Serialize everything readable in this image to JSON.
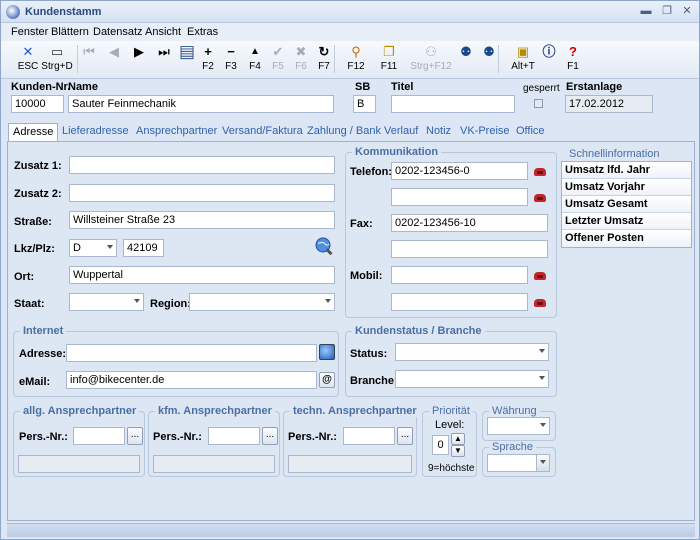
{
  "window": {
    "title": "Kundenstamm"
  },
  "menu": [
    "Fenster",
    "Blättern",
    "Datensatz",
    "Ansicht",
    "Extras"
  ],
  "toolbar": [
    {
      "label": "ESC",
      "icon": "close-icon",
      "symbol": "✕",
      "color": "#1a5cc8"
    },
    {
      "label": "Strg+D",
      "icon": "print-icon",
      "symbol": "🖶",
      "color": "#333"
    },
    {
      "label": "",
      "icon": "first-record-icon",
      "symbol": "⏮",
      "color": "#a6adb8"
    },
    {
      "label": "",
      "icon": "previous-record-icon",
      "symbol": "◀",
      "color": "#a6adb8"
    },
    {
      "label": "",
      "icon": "next-record-icon",
      "symbol": "▶",
      "color": "#222"
    },
    {
      "label": "",
      "icon": "last-record-icon",
      "symbol": "⏭",
      "color": "#222"
    },
    {
      "label": "",
      "icon": "layout-icon",
      "symbol": "▤",
      "color": "#2c4f8a"
    },
    {
      "label": "F2",
      "icon": "add-icon",
      "symbol": "+",
      "color": "#000"
    },
    {
      "label": "F3",
      "icon": "remove-icon",
      "symbol": "−",
      "color": "#000"
    },
    {
      "label": "F4",
      "icon": "edit-icon",
      "symbol": "▲",
      "color": "#000"
    },
    {
      "label": "F5",
      "icon": "check-icon",
      "symbol": "✔",
      "color": "#a6adb8"
    },
    {
      "label": "F6",
      "icon": "cancel-icon",
      "symbol": "✖",
      "color": "#a6adb8"
    },
    {
      "label": "F7",
      "icon": "refresh-icon",
      "symbol": "↻",
      "color": "#000"
    },
    {
      "label": "F12",
      "icon": "broom-icon",
      "symbol": "🧹",
      "color": "#000"
    },
    {
      "label": "F11",
      "icon": "copy-icon",
      "symbol": "❐",
      "color": "#000"
    },
    {
      "label": "Strg+F12",
      "icon": "users-icon",
      "symbol": "👥",
      "color": "#a6adb8"
    },
    {
      "label": "",
      "icon": "contacts-icon",
      "symbol": "☎",
      "color": "#1a4a8a"
    },
    {
      "label": "",
      "icon": "contacts-alt-icon",
      "symbol": "☏",
      "color": "#1a4a8a"
    },
    {
      "label": "Alt+T",
      "icon": "notes-icon",
      "symbol": "▣",
      "color": "#b58a00"
    },
    {
      "label": "",
      "icon": "info-icon",
      "symbol": "ℹ",
      "color": "#1a3c8a"
    },
    {
      "label": "F1",
      "icon": "help-icon",
      "symbol": "?",
      "color": "#c00"
    }
  ],
  "header": {
    "kundennr_label": "Kunden-Nr.",
    "kundennr_value": "10000",
    "name_label": "Name",
    "name_value": "Sauter Feinmechanik",
    "sb_label": "SB",
    "sb_value": "B",
    "titel_label": "Titel",
    "titel_value": "",
    "gesperrt_label": "gesperrt",
    "erstanlage_label": "Erstanlage",
    "erstanlage_value": "17.02.2012"
  },
  "tabs": [
    "Adresse",
    "Lieferadresse",
    "Ansprechpartner",
    "Versand/Faktura",
    "Zahlung / Bank",
    "Verlauf",
    "Notiz",
    "VK-Preise",
    "Office"
  ],
  "address": {
    "zusatz1_label": "Zusatz 1:",
    "zusatz1_value": "",
    "zusatz2_label": "Zusatz 2:",
    "zusatz2_value": "",
    "strasse_label": "Straße:",
    "strasse_value": "Willsteiner Straße 23",
    "lkzplz_label": "Lkz/Plz:",
    "lkz_value": "D",
    "plz_value": "42109",
    "ort_label": "Ort:",
    "ort_value": "Wuppertal",
    "staat_label": "Staat:",
    "staat_value": "",
    "region_label": "Region:",
    "region_value": ""
  },
  "kommunikation": {
    "title": "Kommunikation",
    "telefon_label": "Telefon:",
    "telefon1": "0202-123456-0",
    "telefon2": "",
    "fax_label": "Fax:",
    "fax1": "0202-123456-10",
    "fax2": "",
    "mobil_label": "Mobil:",
    "mobil1": "",
    "mobil2": ""
  },
  "schnellinfo": {
    "title": "Schnellinformation",
    "items": [
      "Umsatz lfd. Jahr",
      "Umsatz Vorjahr",
      "Umsatz Gesamt",
      "Letzter Umsatz",
      "Offener Posten"
    ]
  },
  "internet": {
    "title": "Internet",
    "adresse_label": "Adresse:",
    "adresse_value": "",
    "email_label": "eMail:",
    "email_value": "info@bikecenter.de",
    "email_button": "@"
  },
  "kundenstatus": {
    "title": "Kundenstatus / Branche",
    "status_label": "Status:",
    "status_value": "",
    "branche_label": "Branche:",
    "branche_value": ""
  },
  "ansprech": [
    {
      "title": "allg. Ansprechpartner",
      "label": "Pers.-Nr.:",
      "value": ""
    },
    {
      "title": "kfm. Ansprechpartner",
      "label": "Pers.-Nr.:",
      "value": ""
    },
    {
      "title": "techn. Ansprechpartner",
      "label": "Pers.-Nr.:",
      "value": ""
    }
  ],
  "prioritaet": {
    "title": "Priorität",
    "level_label": "Level:",
    "level_value": "0",
    "hint": "9=höchste"
  },
  "waehrung": {
    "title": "Währung",
    "value": ""
  },
  "sprache": {
    "title": "Sprache",
    "value": ""
  },
  "browse_button": "..."
}
